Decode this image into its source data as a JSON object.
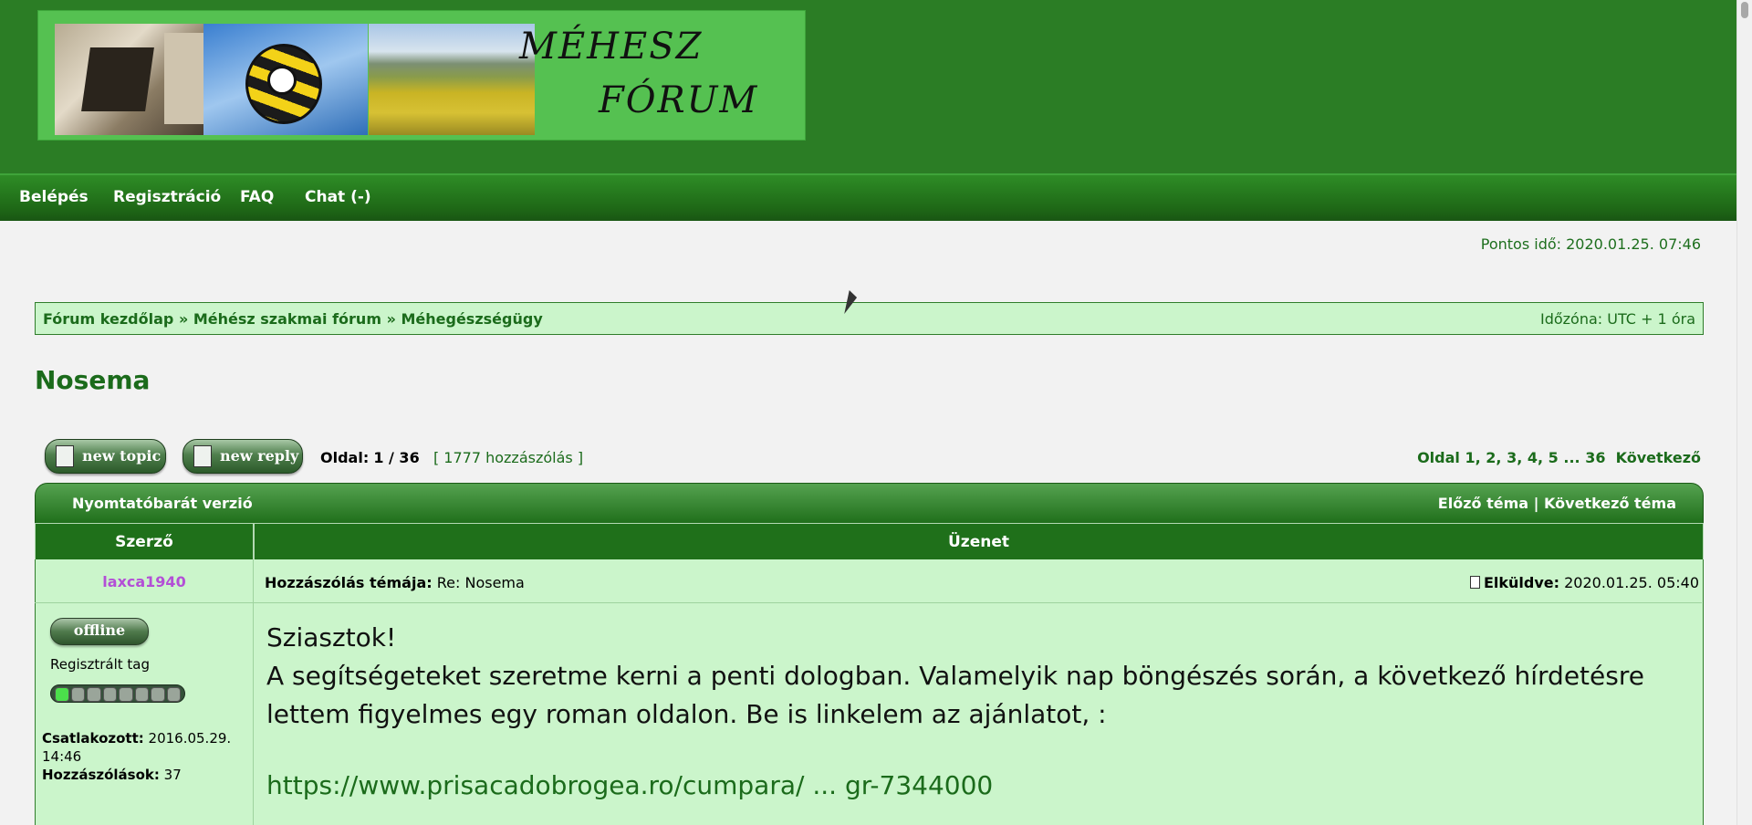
{
  "banner": {
    "title_line1": "MÉHESZ",
    "title_line2": "FÓRUM"
  },
  "nav": {
    "items": [
      "Belépés",
      "Regisztráció",
      "FAQ",
      "Chat (-)"
    ]
  },
  "time": "Pontos idő: 2020.01.25. 07:46",
  "breadcrumb": {
    "items": [
      "Fórum kezdőlap",
      "Méhész szakmai fórum",
      "Méhegészségügy"
    ],
    "separator": "»"
  },
  "timezone": "Időzóna: UTC + 1 óra",
  "topic": {
    "title": "Nosema"
  },
  "buttons": {
    "new_topic": "new topic",
    "new_reply": "new reply"
  },
  "pagination": {
    "page_label": "Oldal:",
    "page_current": "1 / 36",
    "count": "[ 1777 hozzászólás ]",
    "right_label": "Oldal",
    "pages": [
      "1",
      "2",
      "3",
      "4",
      "5"
    ],
    "ellipsis": "...",
    "last": "36",
    "next": "Következő"
  },
  "table": {
    "print_version": "Nyomtatóbarát verzió",
    "prev_topic": "Előző téma",
    "sep": "|",
    "next_topic": "Következő téma",
    "col_author": "Szerző",
    "col_message": "Üzenet"
  },
  "post": {
    "username": "laxca1940",
    "subject_label": "Hozzászólás témája:",
    "subject": "Re: Nosema",
    "sent_label": "Elküldve:",
    "sent": "2020.01.25. 05:40",
    "status": "offline",
    "rank": "Regisztrált tag",
    "rank_level": 1,
    "rank_max": 8,
    "joined_label": "Csatlakozott:",
    "joined": "2016.05.29. 14:46",
    "posts_label": "Hozzászólások:",
    "posts": "37",
    "greeting": "Sziasztok!",
    "body": "A segítségeteket szeretme kerni a penti dologban. Valamelyik nap böngészés során, a következő hírdetésre lettem figyelmes egy roman oldalon. Be is linkelem az ajánlatot, :",
    "link": "https://www.prisacadobrogea.ro/cumpara/ ... gr-7344000"
  },
  "colors": {
    "header_green": "#2b7d25",
    "light_green": "#cbf5cb",
    "text_green": "#1b6b1b",
    "username_purple": "#b34fd6"
  }
}
